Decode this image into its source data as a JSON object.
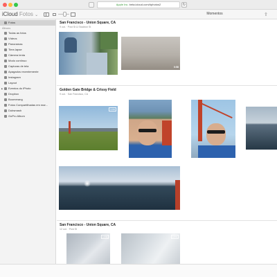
{
  "browser": {
    "url_apple": "Apple Inc.",
    "url_domain": "beta.icloud.com/#photos2",
    "reload_glyph": "↻"
  },
  "toolbar": {
    "brand": "iCloud",
    "brand_app": "Fotos",
    "brand_chevron": "⌄",
    "page_title": "Momentos",
    "upload_glyph": "⇪"
  },
  "sidebar": {
    "items_top": [
      {
        "label": "Fotos",
        "icon": "photos-icon",
        "selected": true
      }
    ],
    "albums_header": "Álbuns",
    "albums": [
      {
        "label": "Todas as fotos",
        "icon": "all-photos-icon"
      },
      {
        "label": "Vídeos",
        "icon": "videos-icon"
      },
      {
        "label": "Panoramas",
        "icon": "panoramas-icon"
      },
      {
        "label": "Time-lapse",
        "icon": "timelapse-icon"
      },
      {
        "label": "Câmera lenta",
        "icon": "slow-motion-icon"
      },
      {
        "label": "Modo contínuo",
        "icon": "burst-icon"
      },
      {
        "label": "Capturas de tela",
        "icon": "screenshots-icon"
      },
      {
        "label": "Apagados recentemente",
        "icon": "trash-icon"
      },
      {
        "label": "Instagram",
        "icon": "album-icon"
      },
      {
        "label": "Layout",
        "icon": "album-icon"
      },
      {
        "label": "Eventos do iPhoto",
        "icon": "folder-icon",
        "disclosure": "▶"
      },
      {
        "label": "Dropbox",
        "icon": "album-icon"
      },
      {
        "label": "Boomerang",
        "icon": "album-icon"
      },
      {
        "label": "Fotos Compartilhadas em mar...",
        "icon": "album-icon"
      },
      {
        "label": "Dubsmash",
        "icon": "album-icon"
      },
      {
        "label": "GoPro Album",
        "icon": "album-icon"
      }
    ]
  },
  "moments": [
    {
      "title": "San Francisco - Union Square, CA",
      "subtitle": "9 out.  ·  Post St & Stockton St"
    },
    {
      "title": "Golden Gate Bridge & Crissy Field",
      "subtitle": "9 out.  ·  San Francisco, CA"
    },
    {
      "title": "San Francisco - Union Square, CA",
      "subtitle": "12 out.  ·  Post St"
    }
  ],
  "photos": {
    "video_duration": "0:58",
    "live_badge": "LIVE"
  }
}
